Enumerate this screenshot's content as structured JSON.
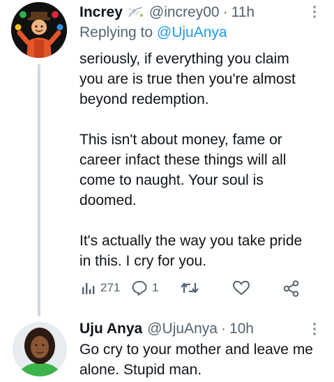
{
  "tweet1": {
    "name": "Increy",
    "badge_icon": "sparkle-leaf-icon",
    "handle": "@increy00",
    "separator": "·",
    "time": "11h",
    "replying_label": "Replying to",
    "replying_to": "@UjuAnya",
    "text": "seriously, if everything you claim\nyou are is true then you're almost\nbeyond redemption.\n\nThis isn't about money, fame or\ncareer infact these things will all\ncome to naught. Your soul is\ndoomed.\n\nIt's actually the way you take pride\nin this. I cry for you.",
    "views": "271",
    "replies": "1"
  },
  "tweet2": {
    "name": "Uju Anya",
    "handle": "@UjuAnya",
    "separator": "·",
    "time": "10h",
    "text": "Go cry to your mother and leave me\nalone. Stupid man."
  },
  "colors": {
    "text": "#0f1419",
    "secondary": "#536471",
    "link": "#1d9bf0",
    "thread_line": "#cfd9de"
  }
}
